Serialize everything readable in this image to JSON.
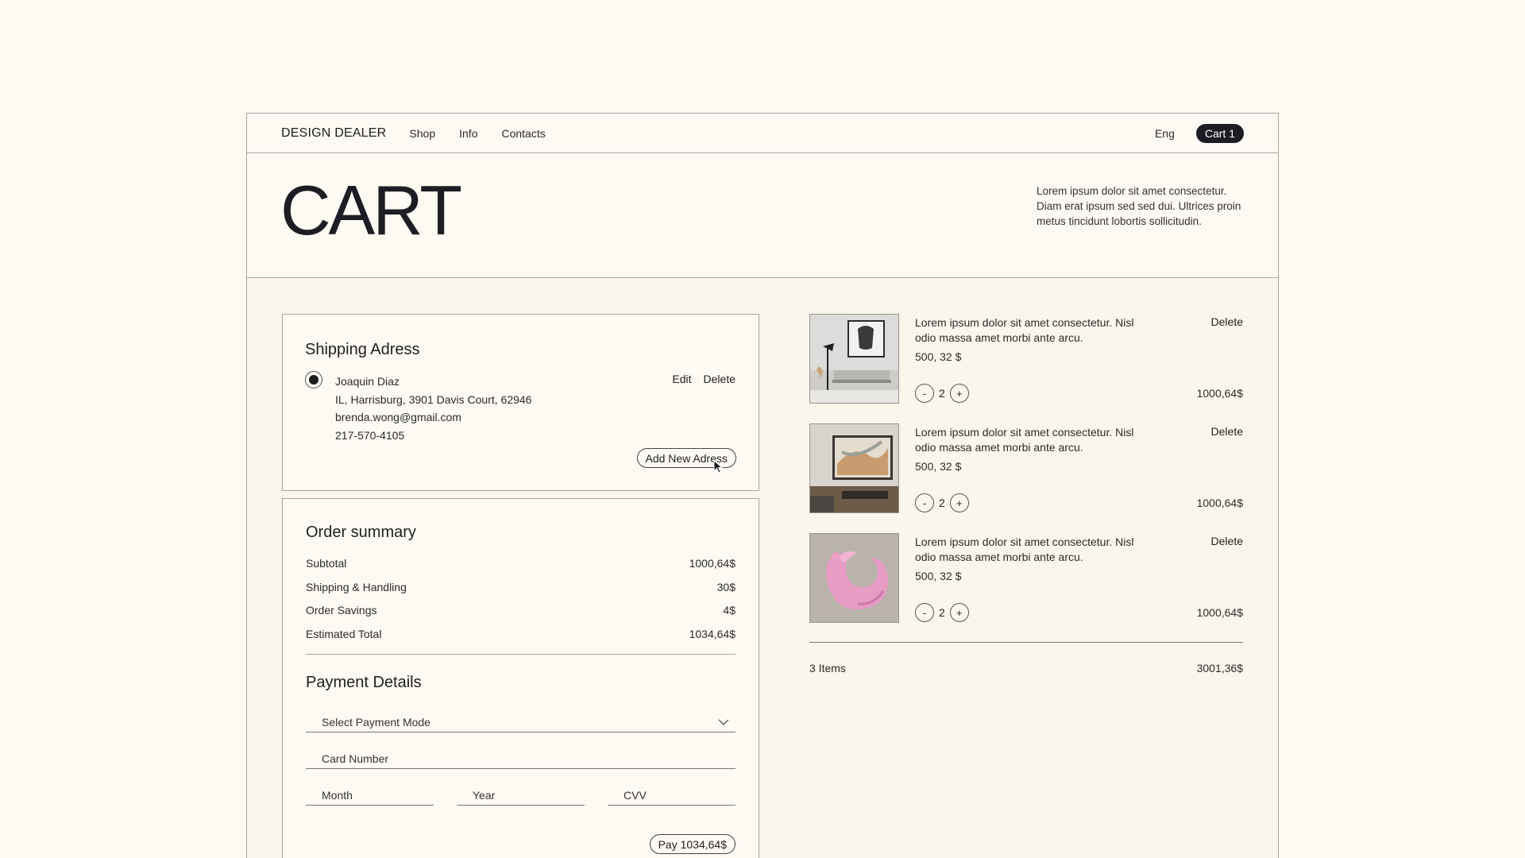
{
  "nav": {
    "brand": "DESIGN DEALER",
    "links": [
      "Shop",
      "Info",
      "Contacts"
    ],
    "lang": "Eng",
    "cart": "Cart 1"
  },
  "hero": {
    "title": "CART",
    "description": "Lorem ipsum dolor sit amet consectetur. Diam erat ipsum sed sed dui. Ultrices proin metus tincidunt lobortis sollicitudin."
  },
  "shipping": {
    "title": "Shipping Adress",
    "name": "Joaquin Diaz",
    "address": "IL, Harrisburg, 3901 Davis Court, 62946",
    "email": "brenda.wong@gmail.com",
    "phone": "217-570-4105",
    "edit_label": "Edit",
    "delete_label": "Delete",
    "add_label": "Add New Adress"
  },
  "order": {
    "title": "Order summary",
    "rows": [
      {
        "label": "Subtotal",
        "value": "1000,64$"
      },
      {
        "label": "Shipping & Handling",
        "value": "30$"
      },
      {
        "label": "Order Savings",
        "value": "4$"
      },
      {
        "label": "Estimated Total",
        "value": "1034,64$"
      }
    ]
  },
  "payment": {
    "title": "Payment Details",
    "mode_placeholder": "Select Payment Mode",
    "card_placeholder": "Card Number",
    "month_placeholder": "Month",
    "year_placeholder": "Year",
    "cvv_placeholder": "CVV",
    "pay_label": "Pay  1034,64$"
  },
  "items": [
    {
      "desc": "Lorem ipsum dolor sit amet consectetur. Nisl odio massa amet morbi ante arcu.",
      "price": "500, 32 $",
      "qty": "2",
      "total": "1000,64$",
      "delete": "Delete",
      "minus": "-",
      "plus": "+"
    },
    {
      "desc": "Lorem ipsum dolor sit amet consectetur. Nisl odio massa amet morbi ante arcu.",
      "price": "500, 32 $",
      "qty": "2",
      "total": "1000,64$",
      "delete": "Delete",
      "minus": "-",
      "plus": "+"
    },
    {
      "desc": "Lorem ipsum dolor sit amet consectetur. Nisl odio massa amet morbi ante arcu.",
      "price": "500, 32 $",
      "qty": "2",
      "total": "1000,64$",
      "delete": "Delete",
      "minus": "-",
      "plus": "+"
    }
  ],
  "cart_footer": {
    "count": "3 Items",
    "total": "3001,36$"
  },
  "colors": {
    "background": "#fdf9f3",
    "accent_dark": "#1c1c22",
    "border": "#aaa69e"
  }
}
